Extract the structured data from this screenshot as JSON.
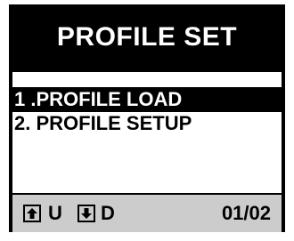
{
  "header": {
    "title": "PROFILE SET"
  },
  "menu": {
    "items": [
      {
        "label": "1 .PROFILE LOAD",
        "selected": true
      },
      {
        "label": "2. PROFILE SETUP",
        "selected": false
      }
    ]
  },
  "footer": {
    "up_icon": "arrow-up-key-icon",
    "up_label": "U",
    "down_icon": "arrow-down-key-icon",
    "down_label": "D",
    "page": "01/02"
  },
  "colors": {
    "screen_background": "#000000",
    "menu_background": "#ffffff",
    "selection_background": "#000000",
    "selection_text": "#ffffff",
    "footer_background": "#cccccc"
  }
}
